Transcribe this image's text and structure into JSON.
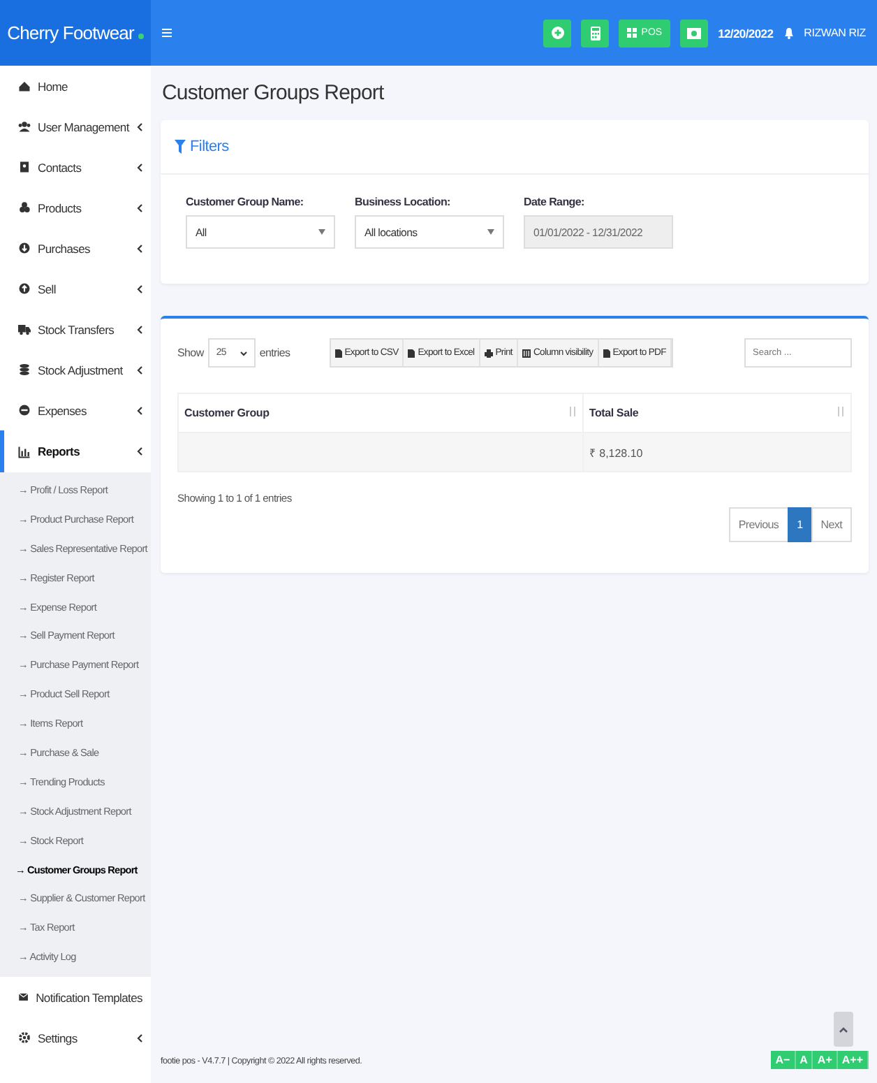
{
  "header": {
    "brand": "Cherry Footwear",
    "pos_label": "POS",
    "date": "12/20/2022",
    "user": "RIZWAN RIZ"
  },
  "sidebar": {
    "items": [
      {
        "label": "Home",
        "expandable": false,
        "selected": false
      },
      {
        "label": "User Management",
        "expandable": true,
        "selected": false
      },
      {
        "label": "Contacts",
        "expandable": true,
        "selected": false
      },
      {
        "label": "Products",
        "expandable": true,
        "selected": false
      },
      {
        "label": "Purchases",
        "expandable": true,
        "selected": false
      },
      {
        "label": "Sell",
        "expandable": true,
        "selected": false
      },
      {
        "label": "Stock Transfers",
        "expandable": true,
        "selected": false
      },
      {
        "label": "Stock Adjustment",
        "expandable": true,
        "selected": false
      },
      {
        "label": "Expenses",
        "expandable": true,
        "selected": false
      },
      {
        "label": "Reports",
        "expandable": true,
        "selected": true,
        "children": [
          {
            "label": "→ Profit / Loss Report",
            "selected": false
          },
          {
            "label": "→ Product Purchase Report",
            "selected": false
          },
          {
            "label": "→ Sales Representative Report",
            "selected": false
          },
          {
            "label": "→ Register Report",
            "selected": false
          },
          {
            "label": "→ Expense Report",
            "selected": false
          },
          {
            "label": "→ Sell Payment Report",
            "selected": false
          },
          {
            "label": "→ Purchase Payment Report",
            "selected": false
          },
          {
            "label": "→ Product Sell Report",
            "selected": false
          },
          {
            "label": "→ Items Report",
            "selected": false
          },
          {
            "label": "→ Purchase & Sale",
            "selected": false
          },
          {
            "label": "→ Trending Products",
            "selected": false
          },
          {
            "label": "→ Stock Adjustment Report",
            "selected": false
          },
          {
            "label": "→ Stock Report",
            "selected": false
          },
          {
            "label": "→ Customer Groups Report",
            "selected": true
          },
          {
            "label": "→ Supplier & Customer Report",
            "selected": false
          },
          {
            "label": "→ Tax Report",
            "selected": false
          },
          {
            "label": "→ Activity Log",
            "selected": false
          }
        ]
      },
      {
        "label": "Notification Templates",
        "expandable": false,
        "selected": false
      },
      {
        "label": "Settings",
        "expandable": true,
        "selected": false
      }
    ]
  },
  "page_title": "Customer Groups Report",
  "filters": {
    "title": "Filters",
    "fields": [
      {
        "label": "Customer Group Name:",
        "kind": "select",
        "value": "All"
      },
      {
        "label": "Business Location:",
        "kind": "select",
        "value": "All locations"
      },
      {
        "label": "Date Range:",
        "kind": "daterange",
        "value": "01/01/2022 - 12/31/2022"
      }
    ]
  },
  "report": {
    "show_label": "Show",
    "page_length": "25",
    "entries_label": "entries",
    "export_buttons": [
      "Export to CSV",
      "Export to Excel",
      "Print",
      "Column visibility",
      "Export to PDF"
    ],
    "search": {
      "placeholder": "Search ..."
    },
    "columns": [
      {
        "label": "Customer Group"
      },
      {
        "label": "Total Sale"
      }
    ],
    "rows": [
      [
        "",
        "₹ 8,128.10"
      ]
    ],
    "info": "Showing 1 to 1 of 1 entries",
    "pagination": [
      {
        "label": "Previous",
        "selected": false
      },
      {
        "label": "1",
        "selected": true
      },
      {
        "label": "Next",
        "selected": false
      }
    ]
  },
  "footer": {
    "text": "footie pos - V4.7.7 | Copyright © 2022 All rights reserved.",
    "font_buttons": [
      "A−",
      "A",
      "A+",
      "A++"
    ]
  }
}
